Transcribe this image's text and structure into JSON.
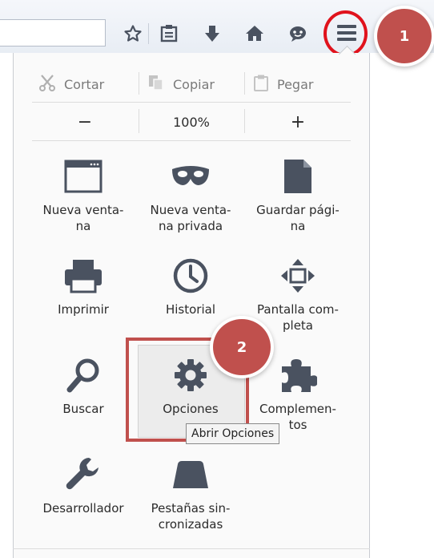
{
  "edit": {
    "cut": "Cortar",
    "copy": "Copiar",
    "paste": "Pegar"
  },
  "zoom": {
    "out": "−",
    "level": "100%",
    "in": "+"
  },
  "tiles": {
    "new_window": "Nueva venta-\nna",
    "private_window": "Nueva venta-\nna privada",
    "save_page": "Guardar pági-\nna",
    "print": "Imprimir",
    "history": "Historial",
    "fullscreen": "Pantalla com-\npleta",
    "find": "Buscar",
    "options": "Opciones",
    "addons": "Complemen-\ntos",
    "developer": "Desarrollador",
    "sync_tabs": "Pestañas sin-\ncronizadas"
  },
  "tooltip": "Abrir Opciones",
  "badges": {
    "step1": "1",
    "step2": "2"
  },
  "colors": {
    "badge": "#c0504d",
    "highlight_ring": "#e0121c",
    "icon": "#4a5260"
  },
  "icons": [
    "bookmark-star-icon",
    "reading-list-icon",
    "download-icon",
    "home-icon",
    "chat-icon",
    "hamburger-menu-icon",
    "scissors-icon",
    "copy-icon",
    "paste-icon",
    "window-icon",
    "mask-icon",
    "page-icon",
    "printer-icon",
    "clock-icon",
    "fullscreen-icon",
    "magnifier-icon",
    "gear-icon",
    "puzzle-icon",
    "wrench-icon",
    "cloud-tab-icon"
  ]
}
